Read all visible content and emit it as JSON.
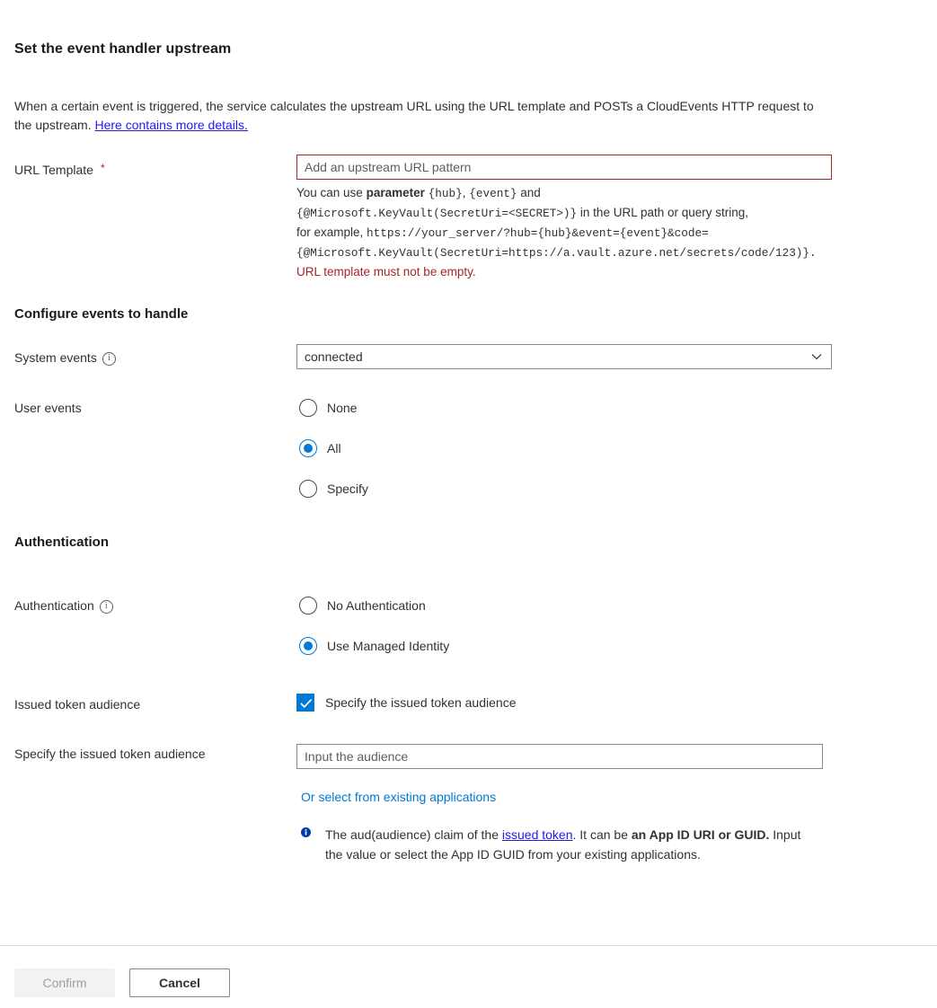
{
  "blade": {
    "title": "Set the event handler upstream",
    "intro_text_1": "When a certain event is triggered, the service calculates the upstream URL using the URL template and POSTs a CloudEvents HTTP request to the upstream. ",
    "intro_link": "Here contains more details."
  },
  "url_template": {
    "label": "URL Template",
    "required_marker": "*",
    "placeholder": "Add an upstream URL pattern",
    "value": "",
    "help": {
      "line1_a": "You can use ",
      "line1_bold": "parameter",
      "line1_b": " ",
      "line1_mono1": "{hub}",
      "line1_c": ", ",
      "line1_mono2": "{event}",
      "line1_d": " and",
      "line2_mono": "{@Microsoft.KeyVault(SecretUri=<SECRET>)}",
      "line2_text": " in the URL path or query string,",
      "line3_text": "for example, ",
      "line3_mono": "https://your_server/?hub={hub}&event={event}&code=",
      "line4_mono": "{@Microsoft.KeyVault(SecretUri=https://a.vault.azure.net/secrets/code/123)}."
    },
    "error": "URL template must not be empty."
  },
  "events_section": {
    "heading": "Configure events to handle",
    "system_events": {
      "label": "System events",
      "selected": "connected"
    },
    "user_events": {
      "label": "User events",
      "options": [
        {
          "label": "None",
          "checked": false
        },
        {
          "label": "All",
          "checked": true
        },
        {
          "label": "Specify",
          "checked": false
        }
      ]
    }
  },
  "auth_section": {
    "heading": "Authentication",
    "auth_mode": {
      "label": "Authentication",
      "options": [
        {
          "label": "No Authentication",
          "checked": false
        },
        {
          "label": "Use Managed Identity",
          "checked": true
        }
      ]
    },
    "issued_token_audience": {
      "label": "Issued token audience",
      "checkbox_label": "Specify the issued token audience",
      "checked": true
    },
    "specify_audience": {
      "label": "Specify the issued token audience",
      "placeholder": "Input the audience",
      "value": "",
      "link": "Or select from existing applications"
    },
    "info": {
      "part1": "The aud(audience) claim of the ",
      "link": "issued token",
      "part2": ". It can be ",
      "bold1": "an App ID URI or GUID.",
      "part3": " Input the value or select the App ID GUID from your existing applications."
    }
  },
  "footer": {
    "confirm_label": "Confirm",
    "cancel_label": "Cancel"
  },
  "colors": {
    "accent": "#0078d4",
    "error": "#a4262c",
    "link": "#2419ec",
    "text": "#323130"
  }
}
